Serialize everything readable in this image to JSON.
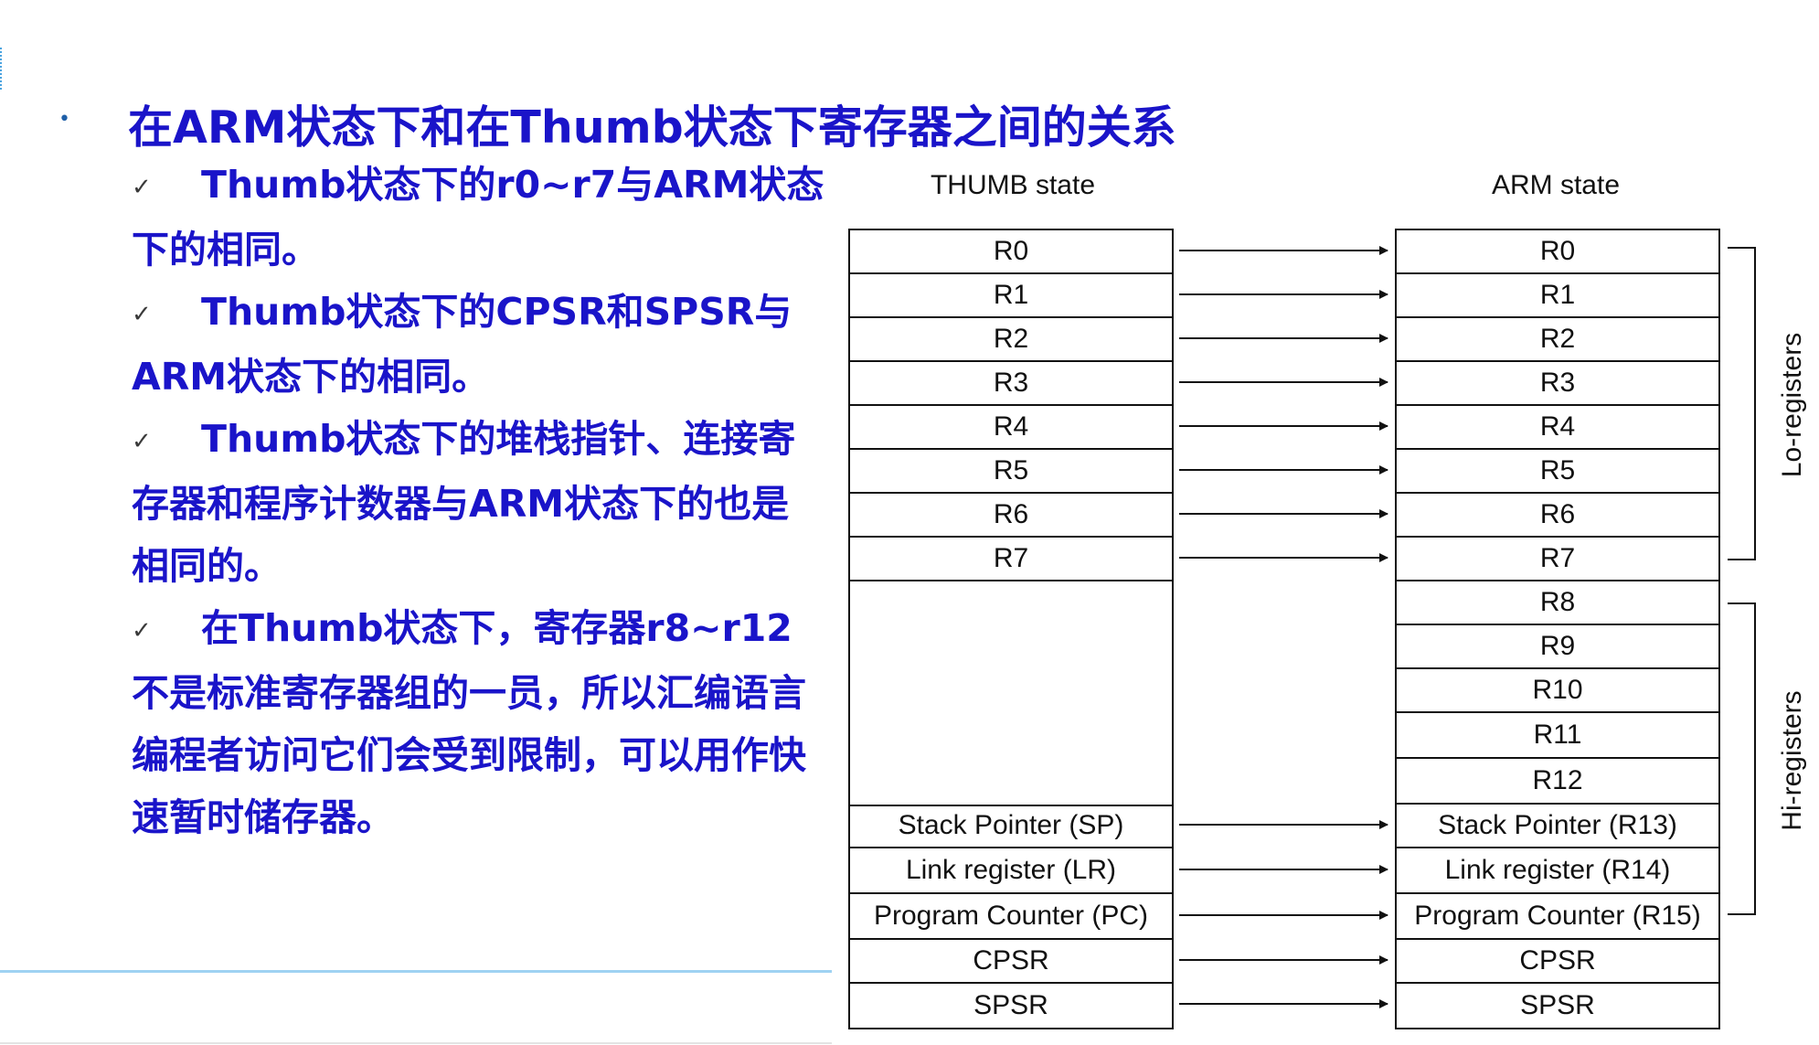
{
  "title": "在ARM状态下和在Thumb状态下寄存器之间的关系",
  "bullets": [
    "Thumb状态下的r0~r7与ARM状态下的相同。",
    "Thumb状态下的CPSR和SPSR与ARM状态下的相同。",
    "Thumb状态下的堆栈指针、连接寄存器和程序计数器与ARM状态下的也是相同的。",
    "在Thumb状态下，寄存器r8~r12不是标准寄存器组的一员，所以汇编语言编程者访问它们会受到限制，可以用作快速暂时储存器。"
  ],
  "diagram": {
    "thumb_header": "THUMB state",
    "arm_header": "ARM state",
    "thumb_registers": [
      "R0",
      "R1",
      "R2",
      "R3",
      "R4",
      "R5",
      "R6",
      "R7",
      "Stack Pointer (SP)",
      "Link register (LR)",
      "Program Counter (PC)",
      "CPSR",
      "SPSR"
    ],
    "arm_registers": [
      "R0",
      "R1",
      "R2",
      "R3",
      "R4",
      "R5",
      "R6",
      "R7",
      "R8",
      "R9",
      "R10",
      "R11",
      "R12",
      "Stack Pointer (R13)",
      "Link register (R14)",
      "Program Counter (R15)",
      "CPSR",
      "SPSR"
    ],
    "lo_label": "Lo-registers",
    "hi_label": "Hi-registers"
  },
  "colors": {
    "text_blue": "#1a14c9",
    "divider": "#9fd2f2"
  }
}
